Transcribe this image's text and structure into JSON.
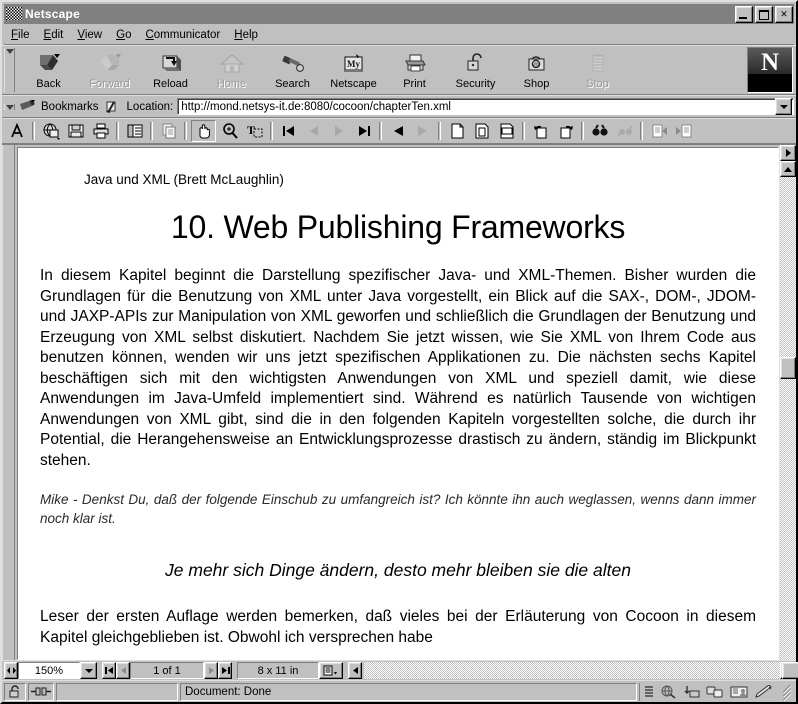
{
  "window": {
    "title": "Netscape",
    "icon": "netscape-window-icon",
    "buttons": {
      "minimize": "_",
      "maximize": "□",
      "close": "✕"
    }
  },
  "menubar": [
    {
      "label": "File",
      "accel": "F"
    },
    {
      "label": "Edit",
      "accel": "E"
    },
    {
      "label": "View",
      "accel": "V"
    },
    {
      "label": "Go",
      "accel": "G"
    },
    {
      "label": "Communicator",
      "accel": "C"
    },
    {
      "label": "Help",
      "accel": "H"
    }
  ],
  "navbar": {
    "buttons": [
      {
        "label": "Back",
        "icon": "back-arrow-icon",
        "enabled": true
      },
      {
        "label": "Forward",
        "icon": "forward-arrow-icon",
        "enabled": false
      },
      {
        "label": "Reload",
        "icon": "reload-icon",
        "enabled": true
      },
      {
        "label": "Home",
        "icon": "home-icon",
        "enabled": false
      },
      {
        "label": "Search",
        "icon": "search-flashlight-icon",
        "enabled": true
      },
      {
        "label": "Netscape",
        "icon": "my-netscape-icon",
        "enabled": true
      },
      {
        "label": "Print",
        "icon": "printer-icon",
        "enabled": true
      },
      {
        "label": "Security",
        "icon": "padlock-open-icon",
        "enabled": true
      },
      {
        "label": "Shop",
        "icon": "shopping-bag-icon",
        "enabled": true
      },
      {
        "label": "Stop",
        "icon": "stop-icon",
        "enabled": false
      }
    ],
    "logo": {
      "letter": "N",
      "name": "netscape-logo"
    }
  },
  "locationbar": {
    "bookmarks_label": "Bookmarks",
    "bookmarks_icon": "bookmark-icon",
    "location_label": "Location:",
    "location_icon": "page-link-icon",
    "url": "http://mond.netsys-it.de:8080/cocoon/chapterTen.xml",
    "url_placeholder": "Location",
    "dropdown_icon": "chevron-down-icon"
  },
  "acrobat_toolbar": {
    "buttons": [
      {
        "name": "acrobat-logo-icon",
        "enabled": true,
        "selected": false
      },
      {
        "name": "web-capture-icon",
        "enabled": true,
        "selected": false
      },
      {
        "name": "save-icon",
        "enabled": true,
        "selected": false
      },
      {
        "name": "print-icon",
        "enabled": true,
        "selected": false
      },
      {
        "name": "show-hide-navpane-icon",
        "enabled": true,
        "selected": false
      },
      {
        "name": "copy-icon",
        "enabled": false,
        "selected": false
      },
      {
        "name": "hand-tool-icon",
        "enabled": true,
        "selected": true
      },
      {
        "name": "zoom-in-tool-icon",
        "enabled": true,
        "selected": false
      },
      {
        "name": "text-select-tool-icon",
        "enabled": true,
        "selected": false
      },
      {
        "name": "first-page-icon",
        "enabled": true,
        "selected": false
      },
      {
        "name": "previous-page-icon",
        "enabled": false,
        "selected": false
      },
      {
        "name": "next-page-icon",
        "enabled": false,
        "selected": false
      },
      {
        "name": "last-page-icon",
        "enabled": true,
        "selected": false
      },
      {
        "name": "go-back-view-icon",
        "enabled": true,
        "selected": false
      },
      {
        "name": "go-forward-view-icon",
        "enabled": false,
        "selected": false
      },
      {
        "name": "actual-size-icon",
        "enabled": true,
        "selected": false
      },
      {
        "name": "fit-page-icon",
        "enabled": true,
        "selected": false
      },
      {
        "name": "fit-width-icon",
        "enabled": true,
        "selected": false
      },
      {
        "name": "rotate-left-icon",
        "enabled": true,
        "selected": false
      },
      {
        "name": "rotate-right-icon",
        "enabled": true,
        "selected": false
      },
      {
        "name": "find-icon",
        "enabled": true,
        "selected": false
      },
      {
        "name": "search-index-icon",
        "enabled": false,
        "selected": false
      },
      {
        "name": "previous-highlight-icon",
        "enabled": false,
        "selected": false
      },
      {
        "name": "next-highlight-icon",
        "enabled": false,
        "selected": false
      }
    ]
  },
  "document": {
    "byline": "Java und XML (Brett McLaughlin)",
    "title": "10. Web Publishing Frameworks",
    "paragraph1": "In diesem Kapitel beginnt die Darstellung spezifischer Java- und XML-Themen.  Bisher wurden die Grundlagen für die Benutzung von XML unter Java vorgestellt, ein Blick auf die SAX-, DOM-, JDOM- und JAXP-APIs zur Manipulation von XML geworfen und schließlich die Grundlagen der Benutzung und Erzeugung von XML selbst diskutiert. Nachdem Sie jetzt wissen, wie Sie XML von Ihrem Code aus benutzen können, wenden wir uns jetzt spezifischen Applikationen zu. Die nächsten sechs Kapitel beschäftigen sich mit den wichtigsten Anwendungen von XML und speziell damit, wie diese Anwendungen im Java-Umfeld  implementiert sind. Während es natürlich Tausende von wichtigen Anwendungen von XML gibt, sind die in den folgenden Kapiteln vorgestellten solche, die durch ihr Potential, die Herangehensweise an Entwicklungsprozesse drastisch zu ändern, ständig im Blickpunkt stehen.",
    "note": "Mike - Denkst Du, daß der folgende Einschub zu umfangreich ist? Ich könnte ihn auch weglassen, wenns dann immer noch klar ist.",
    "heading2": "Je mehr sich Dinge ändern, desto mehr bleiben sie die alten",
    "paragraph2": "Leser der ersten Auflage werden bemerken, daß vieles bei der Erläuterung von Cocoon in diesem Kapitel gleichgeblieben ist. Obwohl ich versprechen habe"
  },
  "acrobat_status": {
    "zoom_value": "150%",
    "zoom_stepper_icon": "zoom-stepper-icon",
    "zoom_dropdown_icon": "chevron-down-icon",
    "first_page_icon": "first-page-icon",
    "prev_page_icon": "previous-page-icon",
    "page_value": "1 of 1",
    "next_page_icon": "next-page-icon",
    "last_page_icon": "last-page-icon",
    "page_size": "8 x 11 in",
    "layout_icon": "page-layout-icon",
    "scroll_left_icon": "scroll-left-icon",
    "scroll_right_icon": "scroll-right-icon"
  },
  "statusbar": {
    "security_icon": "padlock-icon",
    "network_icon": "network-connector-icon",
    "message": "Document: Done",
    "tray_icons": [
      "component-bar-icon",
      "navigator-icon",
      "mailbox-icon",
      "newsgroups-icon",
      "address-book-icon",
      "composer-icon"
    ]
  }
}
